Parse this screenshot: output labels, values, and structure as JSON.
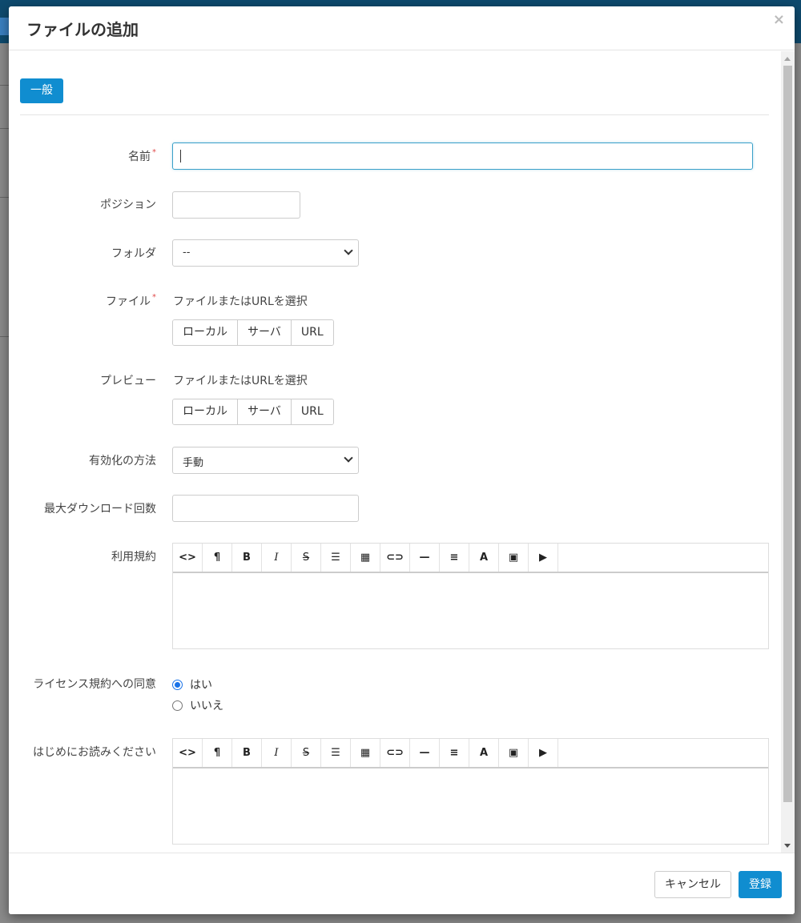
{
  "modal": {
    "title": "ファイルの追加",
    "close_label": "×"
  },
  "tabs": [
    {
      "label": "一般",
      "active": true
    }
  ],
  "fields": {
    "name": {
      "label": "名前",
      "required_mark": "*",
      "value": ""
    },
    "position": {
      "label": "ポジション",
      "value": ""
    },
    "folder": {
      "label": "フォルダ",
      "selected": "--"
    },
    "file": {
      "label": "ファイル",
      "required_mark": "*",
      "hint": "ファイルまたはURLを選択",
      "options": [
        "ローカル",
        "サーバ",
        "URL"
      ]
    },
    "preview": {
      "label": "プレビュー",
      "hint": "ファイルまたはURLを選択",
      "options": [
        "ローカル",
        "サーバ",
        "URL"
      ]
    },
    "activation": {
      "label": "有効化の方法",
      "selected": "手動"
    },
    "max_downloads": {
      "label": "最大ダウンロード回数",
      "value": ""
    },
    "terms": {
      "label": "利用規約"
    },
    "license_agreement": {
      "label": "ライセンス規約への同意",
      "options": [
        {
          "label": "はい",
          "checked": true
        },
        {
          "label": "いいえ",
          "checked": false
        }
      ]
    },
    "readme": {
      "label": "はじめにお読みください"
    }
  },
  "editor_toolbar": [
    {
      "name": "code-view-icon",
      "glyph": "<>"
    },
    {
      "name": "paragraph-icon",
      "glyph": "¶"
    },
    {
      "name": "bold-icon",
      "glyph": "B"
    },
    {
      "name": "italic-icon",
      "glyph": "I"
    },
    {
      "name": "strikethrough-icon",
      "glyph": "S"
    },
    {
      "name": "bulleted-list-icon",
      "glyph": "☰"
    },
    {
      "name": "table-icon",
      "glyph": "▦"
    },
    {
      "name": "link-icon",
      "glyph": "⊂⊃"
    },
    {
      "name": "horizontal-rule-icon",
      "glyph": "—"
    },
    {
      "name": "align-icon",
      "glyph": "≡"
    },
    {
      "name": "font-color-icon",
      "glyph": "A"
    },
    {
      "name": "image-icon",
      "glyph": "▣"
    },
    {
      "name": "video-icon",
      "glyph": "▶"
    }
  ],
  "footer": {
    "cancel_label": "キャンセル",
    "submit_label": "登録"
  },
  "colors": {
    "primary": "#108dd0",
    "required": "#e04b4b",
    "header_bg": "#0e4a6e"
  }
}
